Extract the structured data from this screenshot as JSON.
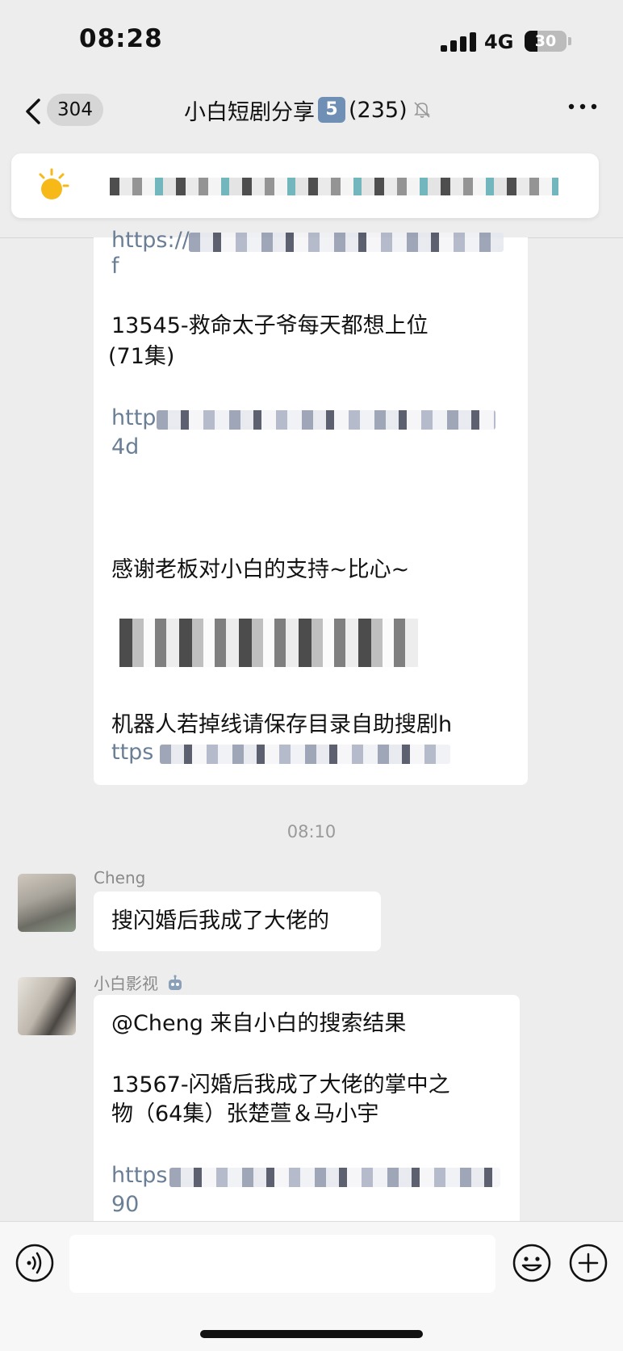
{
  "status_bar": {
    "time": "08:28",
    "network": "4G",
    "battery": "30",
    "battery_level": 0.3
  },
  "header": {
    "back_count": "304",
    "title": "小白短剧分享",
    "title_num": "5",
    "member_count": "(235)"
  },
  "messages": {
    "bot_bubble_1": {
      "lines": [
        "https://",
        "f",
        "13545-救命太子爷每天都想上位",
        "(71集)",
        "http",
        "4d",
        "感谢老板对小白的支持~比心~",
        "机器人若掉线请保存目录自助搜剧h",
        "ttps"
      ]
    },
    "timestamp": "08:10",
    "user_msg": {
      "sender": "Cheng",
      "text": "搜闪婚后我成了大佬的"
    },
    "bot_msg": {
      "sender": "小白影视",
      "lines": [
        "@Cheng 来自小白的搜索结果",
        "13567-闪婚后我成了大佬的掌中之",
        "物（64集）张楚萱＆马小宇",
        "https",
        "90"
      ]
    }
  },
  "input": {
    "placeholder": ""
  },
  "colors": {
    "background": "#ededed",
    "bubble": "#ffffff",
    "link": "#6a7f96",
    "title_badge": "#6f8fb5"
  },
  "icons": [
    "back-icon",
    "mute-icon",
    "more-icon",
    "sun-icon",
    "robot-icon",
    "voice-icon",
    "emoji-icon",
    "plus-icon"
  ]
}
